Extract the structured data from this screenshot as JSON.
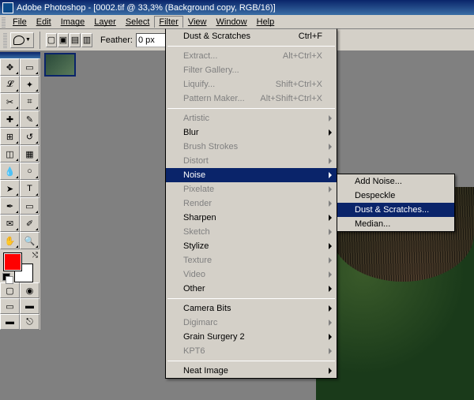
{
  "titlebar": {
    "text": "Adobe Photoshop - [0002.tif @ 33,3% (Background copy, RGB/16)]"
  },
  "menubar": {
    "items": [
      "File",
      "Edit",
      "Image",
      "Layer",
      "Select",
      "Filter",
      "View",
      "Window",
      "Help"
    ],
    "open_index": 5
  },
  "optbar": {
    "feather_label": "Feather:",
    "feather_value": "0 px"
  },
  "toolbox": {
    "tools": [
      [
        "move-tool",
        "marquee-tool"
      ],
      [
        "lasso-tool",
        "magic-wand-tool"
      ],
      [
        "crop-tool",
        "slice-tool"
      ],
      [
        "healing-brush-tool",
        "brush-tool"
      ],
      [
        "clone-stamp-tool",
        "history-brush-tool"
      ],
      [
        "eraser-tool",
        "gradient-tool"
      ],
      [
        "blur-tool",
        "dodge-tool"
      ],
      [
        "path-selection-tool",
        "type-tool"
      ],
      [
        "pen-tool",
        "shape-tool"
      ],
      [
        "notes-tool",
        "eyedropper-tool"
      ],
      [
        "hand-tool",
        "zoom-tool"
      ]
    ],
    "fg_color": "#ff0000",
    "bg_color": "#ffffff"
  },
  "filter_menu": {
    "top": {
      "label": "Dust & Scratches",
      "shortcut": "Ctrl+F"
    },
    "group1": [
      {
        "label": "Extract...",
        "shortcut": "Alt+Ctrl+X",
        "disabled": true
      },
      {
        "label": "Filter Gallery...",
        "shortcut": "",
        "disabled": true
      },
      {
        "label": "Liquify...",
        "shortcut": "Shift+Ctrl+X",
        "disabled": true
      },
      {
        "label": "Pattern Maker...",
        "shortcut": "Alt+Shift+Ctrl+X",
        "disabled": true
      }
    ],
    "group2": [
      {
        "label": "Artistic",
        "disabled": true,
        "submenu": true
      },
      {
        "label": "Blur",
        "disabled": false,
        "submenu": true
      },
      {
        "label": "Brush Strokes",
        "disabled": true,
        "submenu": true
      },
      {
        "label": "Distort",
        "disabled": true,
        "submenu": true
      },
      {
        "label": "Noise",
        "disabled": false,
        "submenu": true,
        "highlighted": true
      },
      {
        "label": "Pixelate",
        "disabled": true,
        "submenu": true
      },
      {
        "label": "Render",
        "disabled": true,
        "submenu": true
      },
      {
        "label": "Sharpen",
        "disabled": false,
        "submenu": true
      },
      {
        "label": "Sketch",
        "disabled": true,
        "submenu": true
      },
      {
        "label": "Stylize",
        "disabled": false,
        "submenu": true
      },
      {
        "label": "Texture",
        "disabled": true,
        "submenu": true
      },
      {
        "label": "Video",
        "disabled": true,
        "submenu": true
      },
      {
        "label": "Other",
        "disabled": false,
        "submenu": true
      }
    ],
    "group3": [
      {
        "label": "Camera Bits",
        "disabled": false,
        "submenu": true
      },
      {
        "label": "Digimarc",
        "disabled": true,
        "submenu": true
      },
      {
        "label": "Grain Surgery 2",
        "disabled": false,
        "submenu": true
      },
      {
        "label": "KPT6",
        "disabled": true,
        "submenu": true
      }
    ],
    "group4": [
      {
        "label": "Neat Image",
        "disabled": false,
        "submenu": true
      }
    ]
  },
  "noise_submenu": {
    "items": [
      {
        "label": "Add Noise..."
      },
      {
        "label": "Despeckle"
      },
      {
        "label": "Dust & Scratches...",
        "highlighted": true
      },
      {
        "label": "Median..."
      }
    ]
  }
}
